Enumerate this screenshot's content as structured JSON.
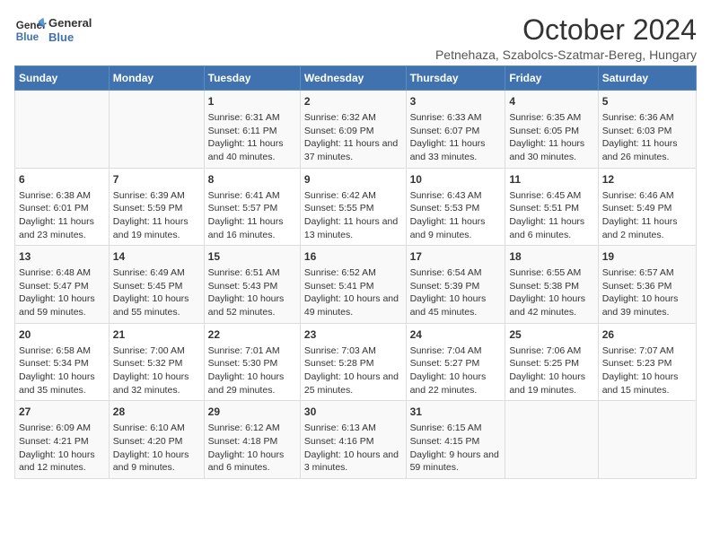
{
  "header": {
    "logo_line1": "General",
    "logo_line2": "Blue",
    "title": "October 2024",
    "subtitle": "Petnehaza, Szabolcs-Szatmar-Bereg, Hungary"
  },
  "days_of_week": [
    "Sunday",
    "Monday",
    "Tuesday",
    "Wednesday",
    "Thursday",
    "Friday",
    "Saturday"
  ],
  "weeks": [
    [
      {
        "day": "",
        "info": ""
      },
      {
        "day": "",
        "info": ""
      },
      {
        "day": "1",
        "info": "Sunrise: 6:31 AM\nSunset: 6:11 PM\nDaylight: 11 hours and 40 minutes."
      },
      {
        "day": "2",
        "info": "Sunrise: 6:32 AM\nSunset: 6:09 PM\nDaylight: 11 hours and 37 minutes."
      },
      {
        "day": "3",
        "info": "Sunrise: 6:33 AM\nSunset: 6:07 PM\nDaylight: 11 hours and 33 minutes."
      },
      {
        "day": "4",
        "info": "Sunrise: 6:35 AM\nSunset: 6:05 PM\nDaylight: 11 hours and 30 minutes."
      },
      {
        "day": "5",
        "info": "Sunrise: 6:36 AM\nSunset: 6:03 PM\nDaylight: 11 hours and 26 minutes."
      }
    ],
    [
      {
        "day": "6",
        "info": "Sunrise: 6:38 AM\nSunset: 6:01 PM\nDaylight: 11 hours and 23 minutes."
      },
      {
        "day": "7",
        "info": "Sunrise: 6:39 AM\nSunset: 5:59 PM\nDaylight: 11 hours and 19 minutes."
      },
      {
        "day": "8",
        "info": "Sunrise: 6:41 AM\nSunset: 5:57 PM\nDaylight: 11 hours and 16 minutes."
      },
      {
        "day": "9",
        "info": "Sunrise: 6:42 AM\nSunset: 5:55 PM\nDaylight: 11 hours and 13 minutes."
      },
      {
        "day": "10",
        "info": "Sunrise: 6:43 AM\nSunset: 5:53 PM\nDaylight: 11 hours and 9 minutes."
      },
      {
        "day": "11",
        "info": "Sunrise: 6:45 AM\nSunset: 5:51 PM\nDaylight: 11 hours and 6 minutes."
      },
      {
        "day": "12",
        "info": "Sunrise: 6:46 AM\nSunset: 5:49 PM\nDaylight: 11 hours and 2 minutes."
      }
    ],
    [
      {
        "day": "13",
        "info": "Sunrise: 6:48 AM\nSunset: 5:47 PM\nDaylight: 10 hours and 59 minutes."
      },
      {
        "day": "14",
        "info": "Sunrise: 6:49 AM\nSunset: 5:45 PM\nDaylight: 10 hours and 55 minutes."
      },
      {
        "day": "15",
        "info": "Sunrise: 6:51 AM\nSunset: 5:43 PM\nDaylight: 10 hours and 52 minutes."
      },
      {
        "day": "16",
        "info": "Sunrise: 6:52 AM\nSunset: 5:41 PM\nDaylight: 10 hours and 49 minutes."
      },
      {
        "day": "17",
        "info": "Sunrise: 6:54 AM\nSunset: 5:39 PM\nDaylight: 10 hours and 45 minutes."
      },
      {
        "day": "18",
        "info": "Sunrise: 6:55 AM\nSunset: 5:38 PM\nDaylight: 10 hours and 42 minutes."
      },
      {
        "day": "19",
        "info": "Sunrise: 6:57 AM\nSunset: 5:36 PM\nDaylight: 10 hours and 39 minutes."
      }
    ],
    [
      {
        "day": "20",
        "info": "Sunrise: 6:58 AM\nSunset: 5:34 PM\nDaylight: 10 hours and 35 minutes."
      },
      {
        "day": "21",
        "info": "Sunrise: 7:00 AM\nSunset: 5:32 PM\nDaylight: 10 hours and 32 minutes."
      },
      {
        "day": "22",
        "info": "Sunrise: 7:01 AM\nSunset: 5:30 PM\nDaylight: 10 hours and 29 minutes."
      },
      {
        "day": "23",
        "info": "Sunrise: 7:03 AM\nSunset: 5:28 PM\nDaylight: 10 hours and 25 minutes."
      },
      {
        "day": "24",
        "info": "Sunrise: 7:04 AM\nSunset: 5:27 PM\nDaylight: 10 hours and 22 minutes."
      },
      {
        "day": "25",
        "info": "Sunrise: 7:06 AM\nSunset: 5:25 PM\nDaylight: 10 hours and 19 minutes."
      },
      {
        "day": "26",
        "info": "Sunrise: 7:07 AM\nSunset: 5:23 PM\nDaylight: 10 hours and 15 minutes."
      }
    ],
    [
      {
        "day": "27",
        "info": "Sunrise: 6:09 AM\nSunset: 4:21 PM\nDaylight: 10 hours and 12 minutes."
      },
      {
        "day": "28",
        "info": "Sunrise: 6:10 AM\nSunset: 4:20 PM\nDaylight: 10 hours and 9 minutes."
      },
      {
        "day": "29",
        "info": "Sunrise: 6:12 AM\nSunset: 4:18 PM\nDaylight: 10 hours and 6 minutes."
      },
      {
        "day": "30",
        "info": "Sunrise: 6:13 AM\nSunset: 4:16 PM\nDaylight: 10 hours and 3 minutes."
      },
      {
        "day": "31",
        "info": "Sunrise: 6:15 AM\nSunset: 4:15 PM\nDaylight: 9 hours and 59 minutes."
      },
      {
        "day": "",
        "info": ""
      },
      {
        "day": "",
        "info": ""
      }
    ]
  ]
}
